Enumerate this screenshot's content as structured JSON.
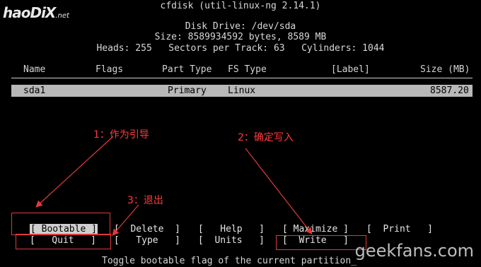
{
  "watermark_logo": {
    "main": "haoDiX",
    "suffix": ".net"
  },
  "header": {
    "title": "cfdisk (util-linux-ng 2.14.1)",
    "disk_drive": "Disk Drive: /dev/sda",
    "size": "Size: 8589934592 bytes, 8589 MB",
    "geometry": "Heads: 255   Sectors per Track: 63   Cylinders: 1044"
  },
  "table": {
    "columns": {
      "name": "Name",
      "flags": "Flags",
      "part_type": "Part Type",
      "fs_type": "FS Type",
      "label": "[Label]",
      "size": "Size (MB)"
    },
    "rows": [
      {
        "name": "sda1",
        "flags": "",
        "part_type": "Primary",
        "fs_type": "Linux",
        "label": "",
        "size": "8587.20"
      }
    ]
  },
  "buttons": {
    "bootable": "[ Bootable ]",
    "delete": "[  Delete  ]",
    "help": "[   Help   ]",
    "maximize": "[ Maximize ]",
    "print": "[  Print   ]",
    "quit": "[   Quit   ]",
    "type": "[   Type   ]",
    "units": "[  Units   ]",
    "write": "[  Write   ]"
  },
  "status_text": "Toggle bootable flag of the current partition_",
  "annotations": {
    "a1": "1：作为引导",
    "a2": "2：确定写入",
    "a3": "3：退出"
  },
  "watermark_bottom": "geekfans.com",
  "colors": {
    "annotation": "#e03a3a",
    "selection": "#b8b8b8",
    "background": "#000000"
  }
}
